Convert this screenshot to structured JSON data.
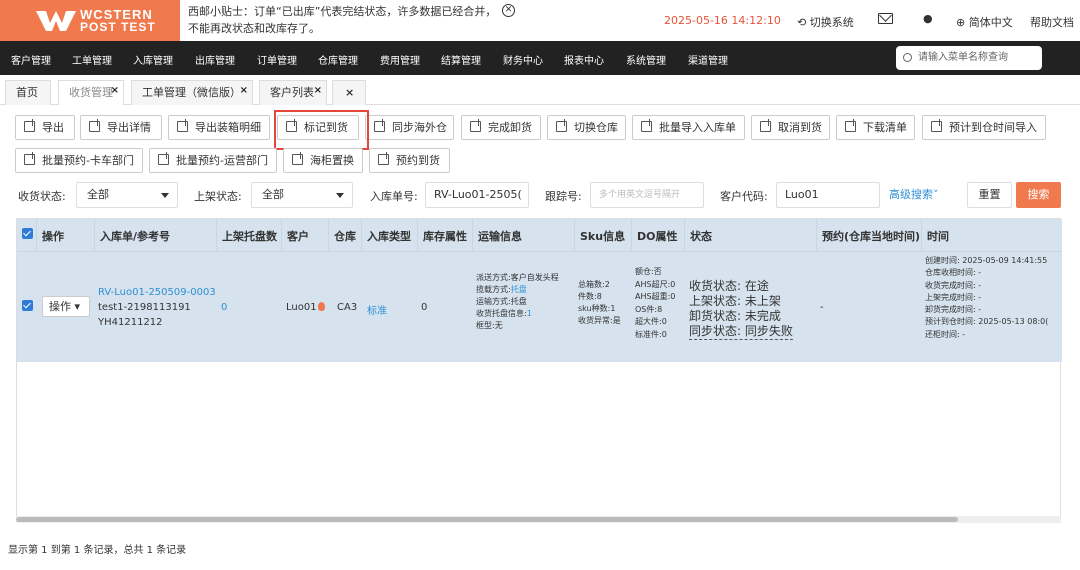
{
  "brand": {
    "line1": "WCSTERN",
    "line2a": "POST",
    "line2b": "TEST"
  },
  "tip": {
    "line1": "西邮小贴士：订单“已出库”代表完结状态，许多数据已经合并，",
    "line2": "不能再改状态和改库存了。",
    "close": "⊗"
  },
  "header": {
    "datetime": "2025-05-16 14:12:10",
    "switch_system": "切换系统",
    "lang": "简体中文",
    "help": "帮助文档"
  },
  "nav": {
    "items": [
      "客户管理",
      "工单管理",
      "入库管理",
      "出库管理",
      "订单管理",
      "仓库管理",
      "费用管理",
      "结算管理",
      "财务中心",
      "报表中心",
      "系统管理",
      "渠道管理"
    ],
    "search_placeholder": "请输入菜单名称查询"
  },
  "tabs": [
    {
      "label": "首页"
    },
    {
      "label": "收货管理"
    },
    {
      "label": "工单管理（微信版）"
    },
    {
      "label": "客户列表"
    },
    {
      "label": ""
    }
  ],
  "actions_row1": [
    "导出",
    "导出详情",
    "导出装箱明细",
    "标记到货",
    "同步海外仓",
    "完成卸货",
    "切换仓库",
    "批量导入入库单",
    "取消到货",
    "下载清单",
    "预计到仓时间导入"
  ],
  "actions_row2": [
    "批量预约-卡车部门",
    "批量预约-运营部门",
    "海柜置换",
    "预约到货"
  ],
  "filters": {
    "receive_status_label": "收货状态:",
    "receive_status_value": "全部",
    "shelf_status_label": "上架状态:",
    "shelf_status_value": "全部",
    "inbound_no_label": "入库单号:",
    "inbound_no_value": "RV-Luo01-2505(",
    "tracking_label": "跟踪号:",
    "tracking_placeholder": "多个用英文逗号隔开",
    "customer_code_label": "客户代码:",
    "customer_code_value": "Luo01",
    "advanced": "高级搜索",
    "reset": "重置",
    "search": "搜索"
  },
  "table": {
    "headers": [
      "操作",
      "入库单/参考号",
      "上架托盘数",
      "客户",
      "仓库",
      "入库类型",
      "库存属性",
      "运输信息",
      "Sku信息",
      "DO属性",
      "状态",
      "预约(仓库当地时间)",
      "时间"
    ],
    "row": {
      "op": "操作",
      "inbound_no": "RV-Luo01-250509-0003",
      "ref1": "test1-2198113191",
      "ref2": "YH41211212",
      "pallets": "0",
      "customer": "Luo01",
      "warehouse": "CA3",
      "inbound_type": "标准",
      "stock_attr": "0",
      "transport": [
        "派送方式:客户自发头程",
        "揽载方式:",
        "托盘",
        "运输方式:托盘",
        "收货托盘信息:",
        "1",
        "框型:无"
      ],
      "sku": [
        "总箱数:2",
        "件数:8",
        "sku种数:1",
        "收货异常:是"
      ],
      "do": [
        "额仓:否",
        "AHS超尺:0",
        "AHS超重:0",
        "OS件:8",
        "超大件:0",
        "标准件:0"
      ],
      "status": [
        {
          "k": "收货状态:",
          "v": "在途"
        },
        {
          "k": "上架状态:",
          "v": "未上架"
        },
        {
          "k": "卸货状态:",
          "v": "未完成"
        },
        {
          "k": "同步状态:",
          "v": "同步失败"
        }
      ],
      "appointment": "-",
      "times": [
        "创建时间: 2025-05-09 14:41:55",
        "仓库收相时间: -",
        "收货完成时间: -",
        "上架完成时间: -",
        "卸货完成时间: -",
        "预计到仓时间: 2025-05-13 08:0(",
        "还柜时间: -"
      ]
    }
  },
  "footer": "显示第 1 到第 1 条记录，总共 1 条记录"
}
